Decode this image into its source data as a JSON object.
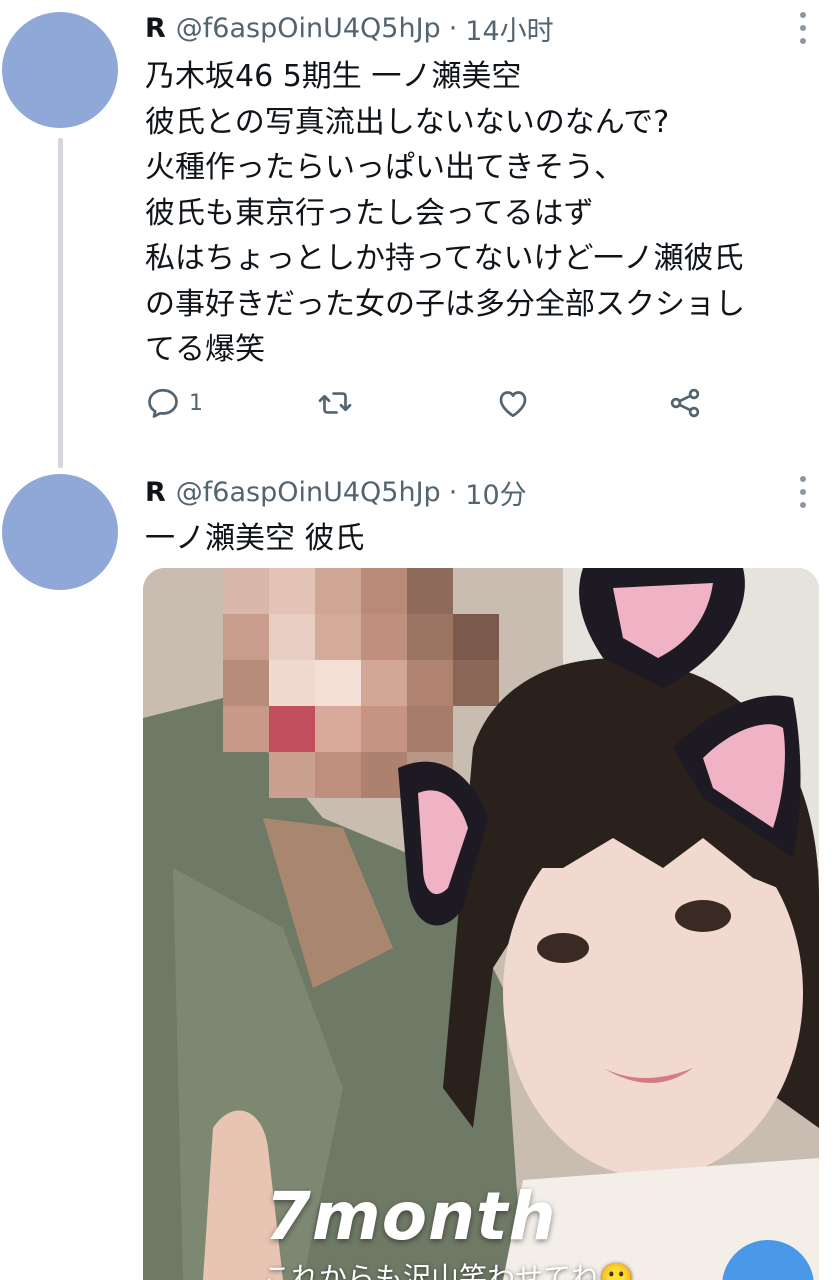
{
  "colors": {
    "avatar": "#8fa8d8",
    "text_primary": "#0f1419",
    "text_secondary": "#536471",
    "thread_line": "#d4d8dc",
    "fab": "#4a99e9"
  },
  "tweets": [
    {
      "author_name": "R",
      "handle": "@f6aspOinU4Q5hJp",
      "separator": "·",
      "time": "14小时",
      "lines": [
        "乃木坂46 5期生 一ノ瀬美空",
        "彼氏との写真流出しないないのなんで?",
        "火種作ったらいっぱい出てきそう、",
        "彼氏も東京行ったし会ってるはず",
        "私はちょっとしか持ってないけど一ノ瀬彼氏",
        "の事好きだった女の子は多分全部スクショし",
        "てる爆笑"
      ],
      "reply_count": "1",
      "icons": [
        "reply-icon",
        "retweet-icon",
        "like-icon",
        "share-icon",
        "more-icon"
      ]
    },
    {
      "author_name": "R",
      "handle": "@f6aspOinU4Q5hJp",
      "separator": "·",
      "time": "10分",
      "lines": [
        "一ノ瀬美空 彼氏"
      ],
      "photo": {
        "caption": "7month",
        "subcaption": "これからも沢山笑わせてね🙂"
      }
    }
  ]
}
